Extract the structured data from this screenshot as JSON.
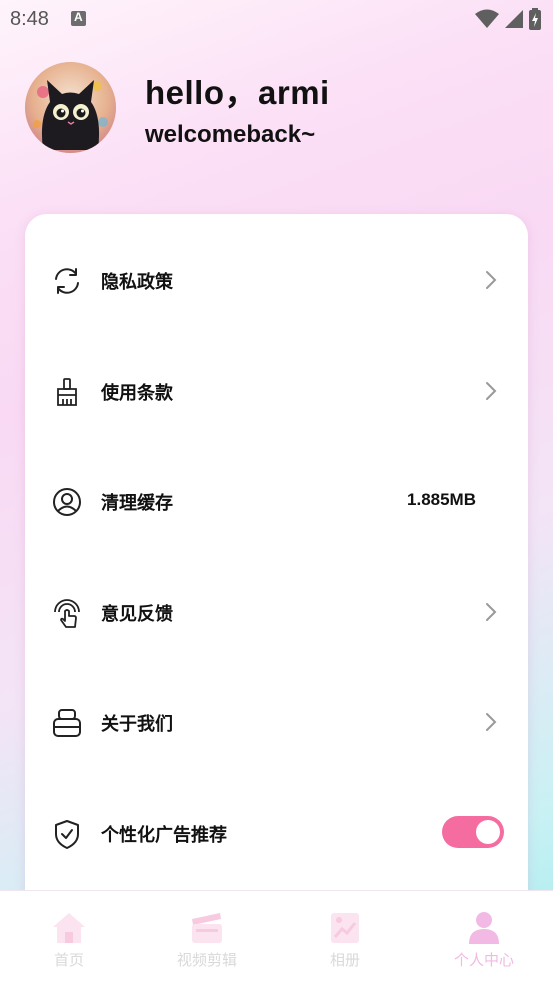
{
  "status_bar": {
    "time": "8:48",
    "app_icon": "a-icon",
    "icons": [
      "wifi-icon",
      "signal-icon",
      "battery-icon"
    ]
  },
  "profile": {
    "greeting": "hello，armi",
    "subtitle": "welcomeback~",
    "avatar_icon": "cat-avatar"
  },
  "menu": [
    {
      "label": "隐私政策",
      "icon": "sync-icon",
      "trailing": "chevron"
    },
    {
      "label": "使用条款",
      "icon": "brush-icon",
      "trailing": "chevron"
    },
    {
      "label": "清理缓存",
      "icon": "user-circle-icon",
      "trailing": "value",
      "value": "1.885MB"
    },
    {
      "label": "意见反馈",
      "icon": "touch-icon",
      "trailing": "chevron"
    },
    {
      "label": "关于我们",
      "icon": "layers-icon",
      "trailing": "chevron"
    },
    {
      "label": "个性化广告推荐",
      "icon": "shield-check-icon",
      "trailing": "toggle",
      "toggle_on": true
    }
  ],
  "nav": [
    {
      "label": "首页",
      "icon": "home-icon",
      "active": false
    },
    {
      "label": "视频剪辑",
      "icon": "clapperboard-icon",
      "active": false
    },
    {
      "label": "相册",
      "icon": "gallery-icon",
      "active": false
    },
    {
      "label": "个人中心",
      "icon": "person-icon",
      "active": true
    }
  ],
  "colors": {
    "accent": "#f56da0",
    "nav_active": "#f2b9e4",
    "nav_inactive": "#d9d9d9"
  }
}
